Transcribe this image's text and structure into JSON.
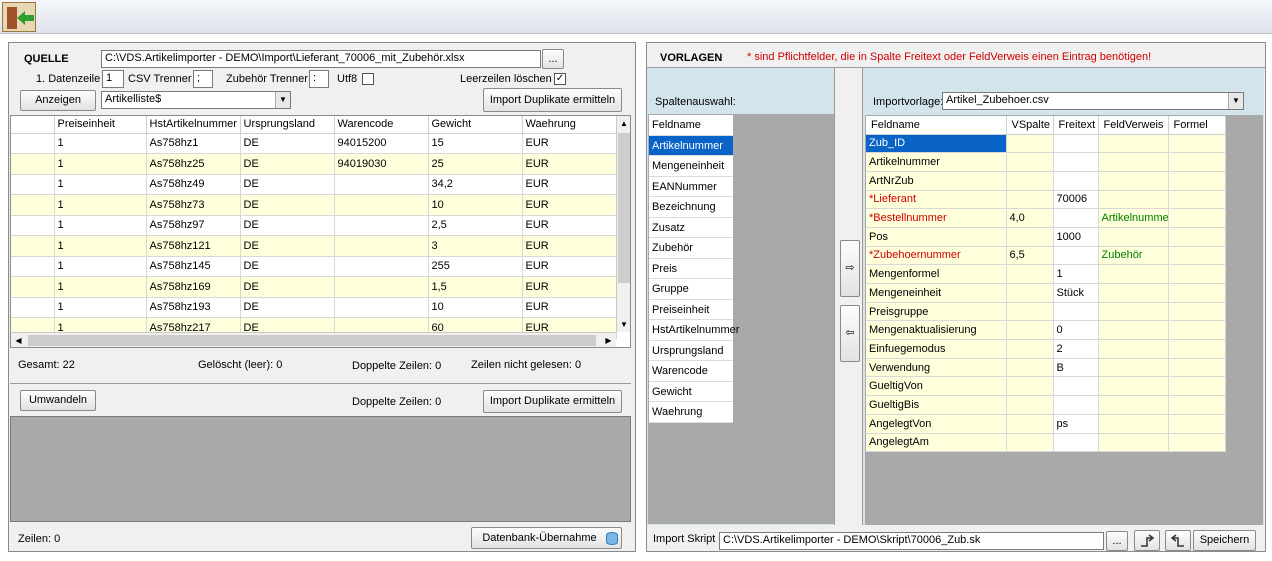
{
  "left": {
    "heading": "QUELLE",
    "file_path": "C:\\VDS.Artikelimporter - DEMO\\Import\\Lieferant_70006_mit_Zubehör.xlsx",
    "browse_label": "...",
    "datenzeile_label": "1. Datenzeile",
    "datenzeile_value": "1",
    "csv_trenner_label": "CSV Trenner",
    "csv_trenner_value": ";",
    "zubehoer_trenner_label": "Zubehör Trenner",
    "zubehoer_trenner_value": ":",
    "utf8_label": "Utf8",
    "leerzeilen_label": "Leerzeilen löschen",
    "leerzeilen_checked": "✓",
    "anzeigen_label": "Anzeigen",
    "sheet_value": "Artikelliste$",
    "import_duplikate_label": "Import Duplikate ermitteln",
    "grid": {
      "columns": [
        "",
        "Preiseinheit",
        "HstArtikelnummer",
        "Ursprungsland",
        "Warencode",
        "Gewicht",
        "Waehrung"
      ],
      "rows": [
        [
          "",
          "1",
          "As758hz1",
          "DE",
          "94015200",
          "15",
          "EUR"
        ],
        [
          "",
          "1",
          "As758hz25",
          "DE",
          "94019030",
          "25",
          "EUR"
        ],
        [
          "",
          "1",
          "As758hz49",
          "DE",
          "",
          "34,2",
          "EUR"
        ],
        [
          "",
          "1",
          "As758hz73",
          "DE",
          "",
          "10",
          "EUR"
        ],
        [
          "",
          "1",
          "As758hz97",
          "DE",
          "",
          "2,5",
          "EUR"
        ],
        [
          "",
          "1",
          "As758hz121",
          "DE",
          "",
          "3",
          "EUR"
        ],
        [
          "",
          "1",
          "As758hz145",
          "DE",
          "",
          "255",
          "EUR"
        ],
        [
          "",
          "1",
          "As758hz169",
          "DE",
          "",
          "1,5",
          "EUR"
        ],
        [
          "",
          "1",
          "As758hz193",
          "DE",
          "",
          "10",
          "EUR"
        ],
        [
          "",
          "1",
          "As758hz217",
          "DE",
          "",
          "60",
          "EUR"
        ]
      ]
    },
    "stats": {
      "gesamt": "Gesamt: 22",
      "geloescht": "Gelöscht (leer): 0",
      "doppelte": "Doppelte Zeilen: 0",
      "nicht_gelesen": "Zeilen nicht gelesen: 0"
    },
    "umwandeln_label": "Umwandeln",
    "doppelte2": "Doppelte Zeilen: 0",
    "import_duplikate2_label": "Import Duplikate ermitteln",
    "zeilen": "Zeilen: 0",
    "db_uebernahme_label": "Datenbank-Übernahme"
  },
  "right": {
    "heading": "VORLAGEN",
    "hint": "* sind Pflichtfelder, die in Spalte Freitext oder FeldVerweis einen Eintrag benötigen!",
    "spaltenauswahl_label": "Spaltenauswahl:",
    "fieldlist": [
      "Feldname",
      "Artikelnummer",
      "Mengeneinheit",
      "EANNummer",
      "Bezeichnung",
      "Zusatz",
      "Zubehör",
      "Preis",
      "Gruppe",
      "Preiseinheit",
      "HstArtikelnummer",
      "Ursprungsland",
      "Warencode",
      "Gewicht",
      "Waehrung"
    ],
    "importvorlage_label": "Importvorlage:",
    "importvorlage_value": "Artikel_Zubehoer.csv",
    "arrow_right": "⇨",
    "arrow_left": "⇦",
    "tgrid": {
      "columns": [
        "Feldname",
        "VSpalte",
        "Freitext",
        "FeldVerweis",
        "Formel"
      ],
      "rows": [
        [
          "Zub_ID",
          "",
          "",
          "",
          ""
        ],
        [
          "Artikelnummer",
          "",
          "",
          "",
          ""
        ],
        [
          "ArtNrZub",
          "",
          "",
          "",
          ""
        ],
        [
          "*Lieferant",
          "",
          "70006",
          "",
          ""
        ],
        [
          "*Bestellnummer",
          "4,0",
          "",
          "Artikelnummer",
          ""
        ],
        [
          "Pos",
          "",
          "1000",
          "",
          ""
        ],
        [
          "*Zubehoernummer",
          "6,5",
          "",
          "Zubehör",
          ""
        ],
        [
          "Mengenformel",
          "",
          "1",
          "",
          ""
        ],
        [
          "Mengeneinheit",
          "",
          "Stück",
          "",
          ""
        ],
        [
          "Preisgruppe",
          "",
          "",
          "",
          ""
        ],
        [
          "Mengenaktualisierung",
          "",
          "0",
          "",
          ""
        ],
        [
          "Einfuegemodus",
          "",
          "2",
          "",
          ""
        ],
        [
          "Verwendung",
          "",
          "B",
          "",
          ""
        ],
        [
          "GueltigVon",
          "",
          "",
          "",
          ""
        ],
        [
          "GueltigBis",
          "",
          "",
          "",
          ""
        ],
        [
          "AngelegtVon",
          "",
          "ps",
          "",
          ""
        ],
        [
          "AngelegtAm",
          "",
          "",
          "",
          ""
        ]
      ]
    },
    "skript_label": "Import Skript",
    "skript_value": "C:\\VDS.Artikelimporter - DEMO\\Skript\\70006_Zub.sk",
    "browse_label": "...",
    "speichern_label": "Speichern"
  },
  "colors": {
    "highlight": "#ffffdc",
    "selection": "#0a64c8",
    "required": "#d00000",
    "reference": "#008000"
  }
}
